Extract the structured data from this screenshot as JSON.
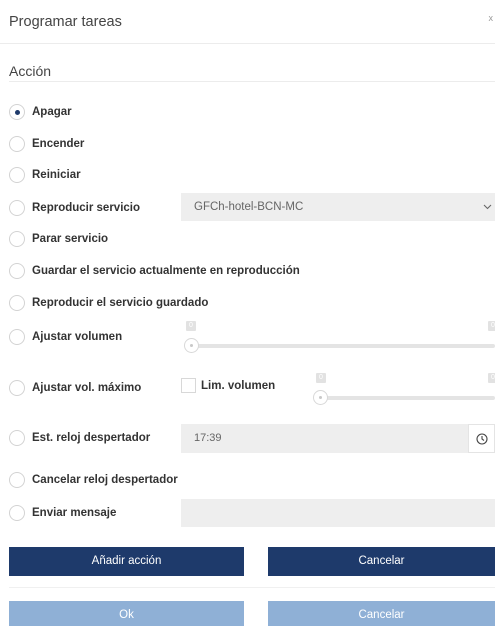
{
  "dialog": {
    "title": "Programar tareas",
    "close_glyph": "x",
    "close_icon": "close-icon"
  },
  "section": {
    "title": "Acción"
  },
  "actions": [
    {
      "label": "Apagar",
      "checked": true
    },
    {
      "label": "Encender",
      "checked": false
    },
    {
      "label": "Reiniciar",
      "checked": false
    },
    {
      "label": "Reproducir servicio",
      "checked": false
    },
    {
      "label": "Parar servicio",
      "checked": false
    },
    {
      "label": "Guardar el servicio actualmente en reproducción",
      "checked": false
    },
    {
      "label": "Reproducir el servicio guardado",
      "checked": false
    },
    {
      "label": "Ajustar volumen",
      "checked": false
    },
    {
      "label": "Ajustar vol. máximo",
      "checked": false
    },
    {
      "label": "Est. reloj despertador",
      "checked": false
    },
    {
      "label": "Cancelar reloj despertador",
      "checked": false
    },
    {
      "label": "Enviar mensaje",
      "checked": false
    }
  ],
  "service_select": {
    "value": "GFCh-hotel-BCN-MC",
    "icon": "chevron-down-icon"
  },
  "volume_slider": {
    "min_label": "0",
    "max_label": "0",
    "value": 0
  },
  "max_volume": {
    "checkbox_label": "Lim. volumen",
    "checked": false,
    "slider_min_label": "0",
    "slider_max_label": "0",
    "value": 0
  },
  "alarm": {
    "time": "17:39",
    "icon": "clock-icon"
  },
  "message": {
    "value": ""
  },
  "buttons": {
    "add_action": "Añadir acción",
    "cancel_action": "Cancelar",
    "ok": "Ok",
    "cancel": "Cancelar"
  },
  "colors": {
    "primary": "#1e3a6b",
    "primary_disabled": "#8fb0d6",
    "input_bg": "#eeeeee"
  }
}
